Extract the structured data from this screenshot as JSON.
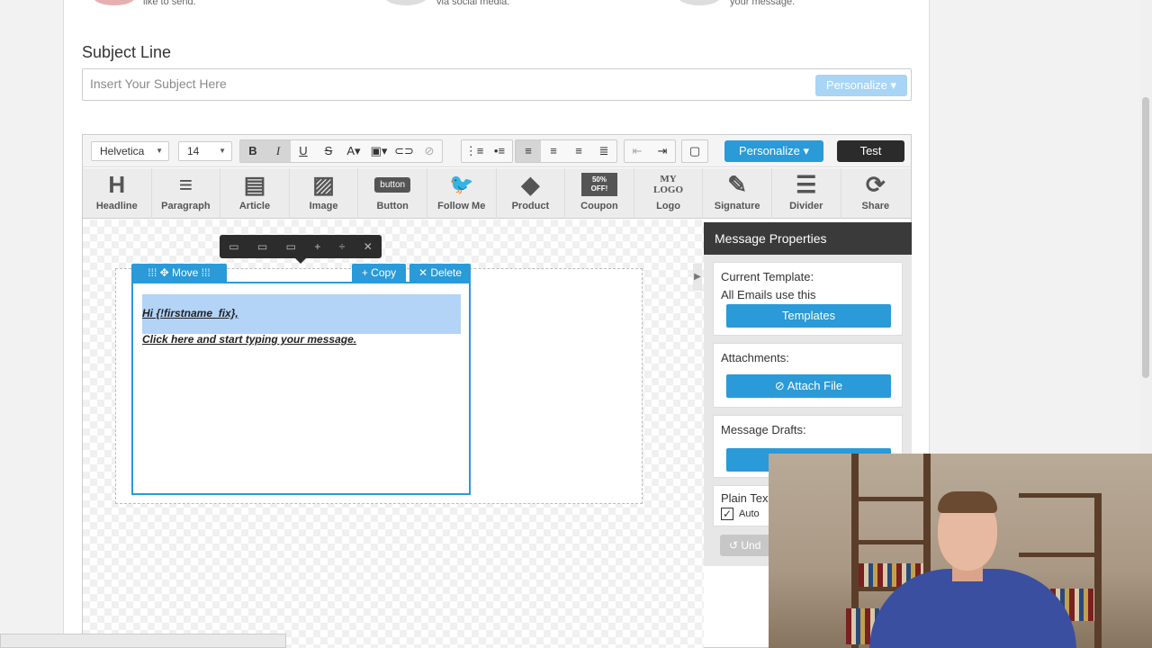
{
  "top_steps": [
    "like to send.",
    "via social media.",
    "your message."
  ],
  "subject": {
    "label": "Subject Line",
    "placeholder": "Insert Your Subject Here",
    "personalize_label": "Personalize"
  },
  "toolbar": {
    "font_family": "Helvetica",
    "font_size": "14",
    "personalize_label": "Personalize",
    "test_label": "Test"
  },
  "blocks": [
    {
      "label": "Headline",
      "icon": "H"
    },
    {
      "label": "Paragraph",
      "icon": "≡"
    },
    {
      "label": "Article",
      "icon": "▤"
    },
    {
      "label": "Image",
      "icon": "▨"
    },
    {
      "label": "Button",
      "icon": "button"
    },
    {
      "label": "Follow Me",
      "icon": "🐦"
    },
    {
      "label": "Product",
      "icon": "◆"
    },
    {
      "label": "Coupon",
      "icon": "50% OFF!"
    },
    {
      "label": "Logo",
      "icon": "MY LOGO"
    },
    {
      "label": "Signature",
      "icon": "✎"
    },
    {
      "label": "Divider",
      "icon": "☰"
    },
    {
      "label": "Share",
      "icon": "⟳"
    }
  ],
  "content_block": {
    "move_label": "Move",
    "copy_label": "Copy",
    "delete_label": "Delete",
    "line1": "Hi {!firstname_fix},",
    "line2": "Click here and start typing your message."
  },
  "panel": {
    "title": "Message Properties",
    "current_template_label": "Current Template:",
    "current_template_value": "All Emails use this",
    "templates_button": "Templates",
    "attachments_label": "Attachments:",
    "attach_button": "Attach File",
    "drafts_label": "Message Drafts:",
    "plain_text_label": "Plain Tex",
    "auto_label": "Auto",
    "undo_label": "Und"
  }
}
